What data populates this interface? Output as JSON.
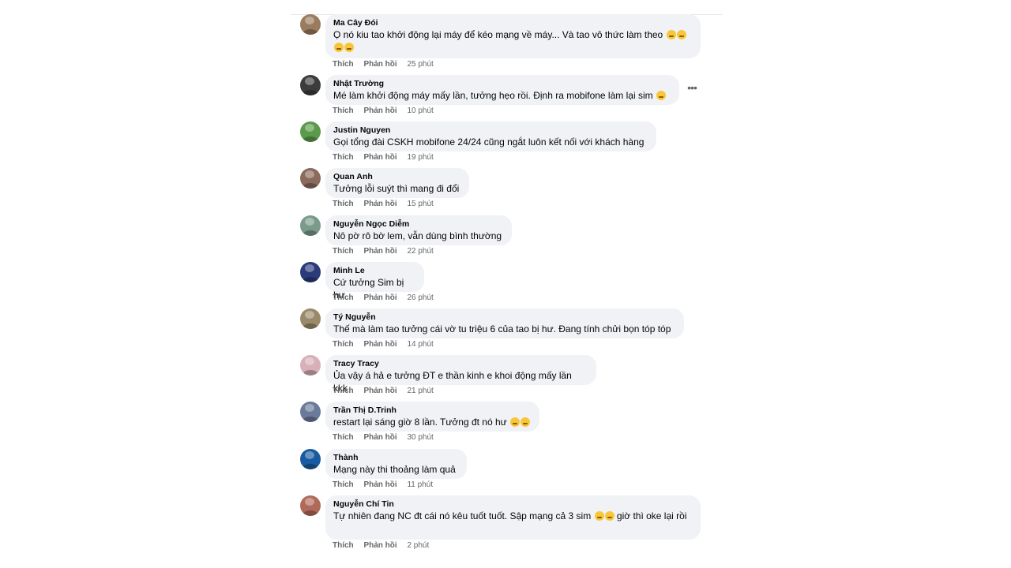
{
  "actions": {
    "like": "Thích",
    "reply": "Phản hồi"
  },
  "comments": [
    {
      "author": "Ma Cây Đói",
      "text": "Ọ nó kiu tao khởi động lại máy để kéo mạng về máy... Và tao vô thức làm theo",
      "emoji": [
        "grin",
        "grin",
        "grin",
        "grin"
      ],
      "time": "25 phút",
      "avatar_color": "#9a7b5f"
    },
    {
      "author": "Nhật Trường",
      "text": "Mé làm khởi động máy mấy lần, tưởng hẹo rồi. Định ra mobifone làm lại sim",
      "emoji": [
        "rofl"
      ],
      "time": "10 phút",
      "avatar_color": "#3c3c3c"
    },
    {
      "author": "Justin Nguyen",
      "text": "Gọi tổng đài CSKH mobifone 24/24 cũng ngắt luôn kết nối với khách hàng",
      "emoji": [],
      "time": "19 phút",
      "avatar_color": "#5a9a4a"
    },
    {
      "author": "Quan Anh",
      "text": "Tưởng lỗi suýt thì mang đi đổi",
      "emoji": [],
      "time": "15 phút",
      "avatar_color": "#8a6a5a"
    },
    {
      "author": "Nguyễn Ngọc Diễm",
      "text": "Nô pờ rô bờ lem, vẫn dùng bình thường",
      "emoji": [],
      "time": "22 phút",
      "avatar_color": "#7a9a8a"
    },
    {
      "author": "Minh Le",
      "text": "Cứ tưởng Sim bị hư",
      "emoji": [],
      "time": "26 phút",
      "avatar_color": "#2a3a7a"
    },
    {
      "author": "Tý Nguyễn",
      "text": "Thế mà làm tao tưởng cái vờ tu triệu 6 của tao bị hư. Đang tính chửi bọn tóp tóp",
      "emoji": [],
      "time": "14 phút",
      "avatar_color": "#9a8a6a"
    },
    {
      "author": "Tracy Tracy",
      "text": "Ủa vậy á hả e tưởng ĐT e thần kinh e khoi động mấy lần kkk",
      "emoji": [],
      "time": "21 phút",
      "avatar_color": "#d8b0b8"
    },
    {
      "author": "Trần Thị D.Trinh",
      "text": "restart lại sáng giờ 8 lần. Tưởng đt nó hư",
      "emoji": [
        "sad",
        "sad"
      ],
      "time": "30 phút",
      "avatar_color": "#6a7a9a"
    },
    {
      "author": "Thành",
      "text": "Mạng này thi thoảng làm quả",
      "emoji": [],
      "time": "11 phút",
      "avatar_color": "#1a5aa0"
    },
    {
      "author": "Nguyễn Chí Tin",
      "text": "Tự nhiên đang NC đt cái nó kêu tuốt tuốt. Sập mạng cả 3 sim",
      "emoji": [
        "grin",
        "grin"
      ],
      "text_after": " giờ thì oke lại rồi",
      "time": "2 phút",
      "avatar_color": "#b06a5a"
    }
  ]
}
